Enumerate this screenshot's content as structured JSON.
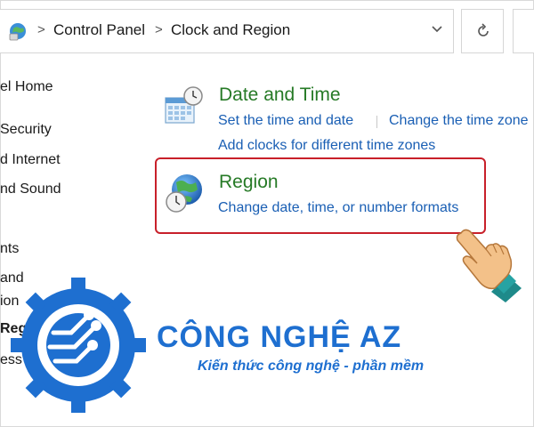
{
  "address_bar": {
    "breadcrumbs": [
      "Control Panel",
      "Clock and Region"
    ],
    "icon": "control-panel-icon"
  },
  "sidebar": {
    "items": [
      {
        "label": "el Home",
        "bold": false
      },
      {
        "label": " Security",
        "bold": false
      },
      {
        "label": "d Internet",
        "bold": false
      },
      {
        "label": "nd Sound",
        "bold": false
      },
      {
        "label": "nts",
        "bold": false
      },
      {
        "label": " and",
        "bold": false
      },
      {
        "label": "ion",
        "bold": false
      },
      {
        "label": "Reg",
        "bold": true
      },
      {
        "label": "ess",
        "bold": false
      }
    ]
  },
  "categories": [
    {
      "title": "Date and Time",
      "icon": "calendar-clock-icon",
      "links": [
        "Set the time and date",
        "Change the time zone",
        "Add clocks for different time zones"
      ]
    },
    {
      "title": "Region",
      "icon": "globe-clock-icon",
      "links": [
        "Change date, time, or number formats"
      ]
    }
  ],
  "watermark": {
    "brand": "CÔNG NGHỆ AZ",
    "tagline": "Kiến thức công nghệ - phần mềm"
  },
  "colors": {
    "link": "#1a5fb4",
    "category_title": "#267a26",
    "highlight": "#c8202a",
    "brand": "#1e6fd0"
  }
}
